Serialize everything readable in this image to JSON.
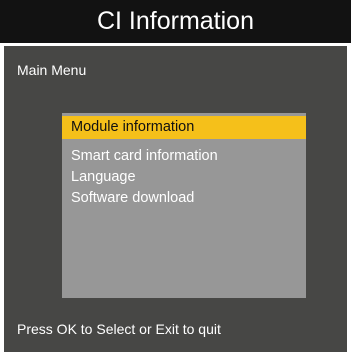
{
  "header": {
    "title": "CI Information"
  },
  "menu": {
    "title": "Main Menu",
    "items": [
      {
        "label": "Module information",
        "selected": true
      },
      {
        "label": "Smart card information",
        "selected": false
      },
      {
        "label": " Language",
        "selected": false
      },
      {
        "label": "Software download",
        "selected": false
      }
    ]
  },
  "footer": {
    "hint": "Press OK to Select or Exit to quit"
  },
  "colors": {
    "header_bg": "#121212",
    "panel_bg": "#474745",
    "menu_bg": "#979797",
    "highlight": "#f5c01a",
    "text": "#ffffff"
  }
}
